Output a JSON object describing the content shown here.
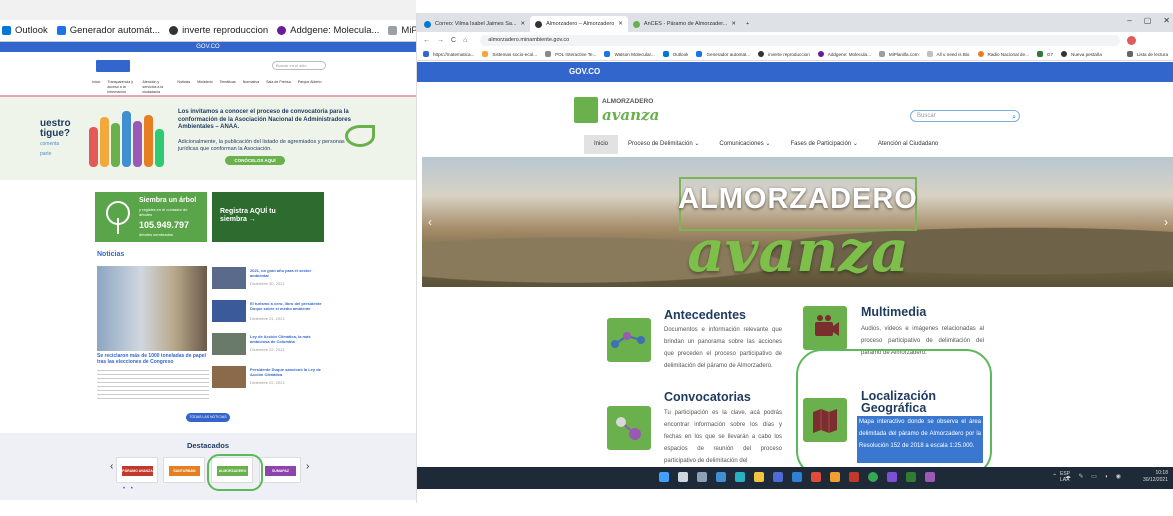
{
  "left": {
    "bookmarks": [
      {
        "label": "Outlook",
        "color": "#0078d4"
      },
      {
        "label": "Generador automát...",
        "color": "#1a73e8"
      },
      {
        "label": "inverte reproduccion",
        "color": "#333333"
      },
      {
        "label": "Addgene: Molecula...",
        "color": "#6a1b9a"
      },
      {
        "label": "MiPlanilla.com",
        "color": "#9aa0a6"
      }
    ],
    "gov": "GOV.CO",
    "search_placeholder": "Buscar en el sitio",
    "nav": [
      "Inicio",
      "Transparencia y acceso a la información pública",
      "Atención y servicios a la ciudadanía",
      "Noticias",
      "Ministerio",
      "Temáticas",
      "Normativa",
      "Sala de Prensa",
      "Parque Abierto"
    ],
    "banner": {
      "side_title": "uestro tigue?",
      "side_sub": "comenta parte",
      "text1": "Los invitamos a conocer el proceso de convocatoria para la conformación de la Asociación Nacional de Administradores Ambientales – ANAA.",
      "text2": "Adicionalmente, la publicación del listado de agremiados y personas jurídicas que conforman la Asociación.",
      "button": "CONÓCELOS AQUÍ"
    },
    "card1": {
      "title": "Siembra un árbol",
      "sub": "y registra en el contador de árboles",
      "number": "105.949.797",
      "small": "árboles sembrados"
    },
    "card2": {
      "title": "Registra AQUÍ tu siembra →"
    },
    "news_title": "Noticias",
    "news_main": "Se reciclaron más de 1000 toneladas de papel tras las elecciones de Congreso",
    "news_items": [
      "2021, un gran año para el sector ambiental",
      "El turismo a cero, libro del presidente Duque sobre el medio ambiente",
      "Ley de Acción Climática, la más ambiciosa de Colombia",
      "Presidente Duque sancionó la Ley de Acción Climática"
    ],
    "news_dates": [
      "Diciembre 30, 2021",
      "Diciembre 21, 2021",
      "Diciembre 22, 2021",
      "Diciembre 22, 2021"
    ],
    "all_news": "TODAS LAS NOTICIAS",
    "destacados_title": "Destacados",
    "destacados": [
      "PÁRAMO AVANZA",
      "SANTURBÁN AVANZA",
      "ALMORZADERO AVANZA",
      "SUMAPAZ AVANZA"
    ],
    "prev": "‹",
    "next": "›",
    "dots": "• •"
  },
  "right": {
    "tabs": [
      {
        "label": "Correo: Vilma Isabel Jaimes Sa...",
        "icon_color": "#0078d4"
      },
      {
        "label": "Almorzadero – Almorzadero",
        "icon_color": "#333333"
      },
      {
        "label": "AnCES - Páramo de Almorzader...",
        "icon_color": "#6ab04c"
      }
    ],
    "new_tab": "+",
    "window_controls": [
      "–",
      "▢",
      "✕"
    ],
    "url": "almorzadero.minambiente.gov.co",
    "nav_glyphs": [
      "←",
      "→",
      "C",
      "⌂"
    ],
    "bookmarks": [
      "https://matematica...",
      "Sistemas socio-ecol...",
      "POL Interactive Te...",
      "Watson Molecular...",
      "Outlook",
      "Generador automat...",
      "inverte reproduccion",
      "Addgene: Molecula...",
      "MiPlanilla.com",
      "All u need is Bio",
      "Radio Nacional de...",
      "G7",
      "Nueva pestaña"
    ],
    "reading_list": "Lista de lectura",
    "gov": "GOV.CO",
    "logo_t1": "ALMORZADERO",
    "logo_t2": "avanza",
    "search_placeholder": "Buscar",
    "nav": [
      "Inicio",
      "Proceso de Delimitación ⌄",
      "Comunicaciones ⌄",
      "Fases de Participación ⌄",
      "Atención al Ciudadano"
    ],
    "hero_t1": "ALMORZADERO",
    "hero_t2": "avanza",
    "hero_prev": "‹",
    "hero_next": "›",
    "sections": {
      "antecedentes": {
        "title": "Antecedentes",
        "text": "Documentos e información relevante que brindan un panorama sobre las acciones que preceden el proceso participativo de delimitación del páramo de Almorzadero."
      },
      "convocatorias": {
        "title": "Convocatorias",
        "text": "Tu participación es la clave, acá podrás encontrar información sobre los días y fechas en los que se llevarán a cabo los espacios de reunión del proceso participativo de delimitación del"
      },
      "multimedia": {
        "title": "Multimedia",
        "text": "Audios, videos e imágenes relacionadas al proceso participativo de delimitación del páramo de Almorzadero."
      },
      "localizacion": {
        "title": "Localización Geográfica",
        "text": "Mapa interactivo donde se observa el área delimitada del páramo de Almorzadero por la Resolución 152 de 2018 a escala 1:25.000."
      }
    },
    "tray": {
      "lang": "ESP LAA",
      "time": "10:18",
      "date": "30/12/2021"
    }
  }
}
